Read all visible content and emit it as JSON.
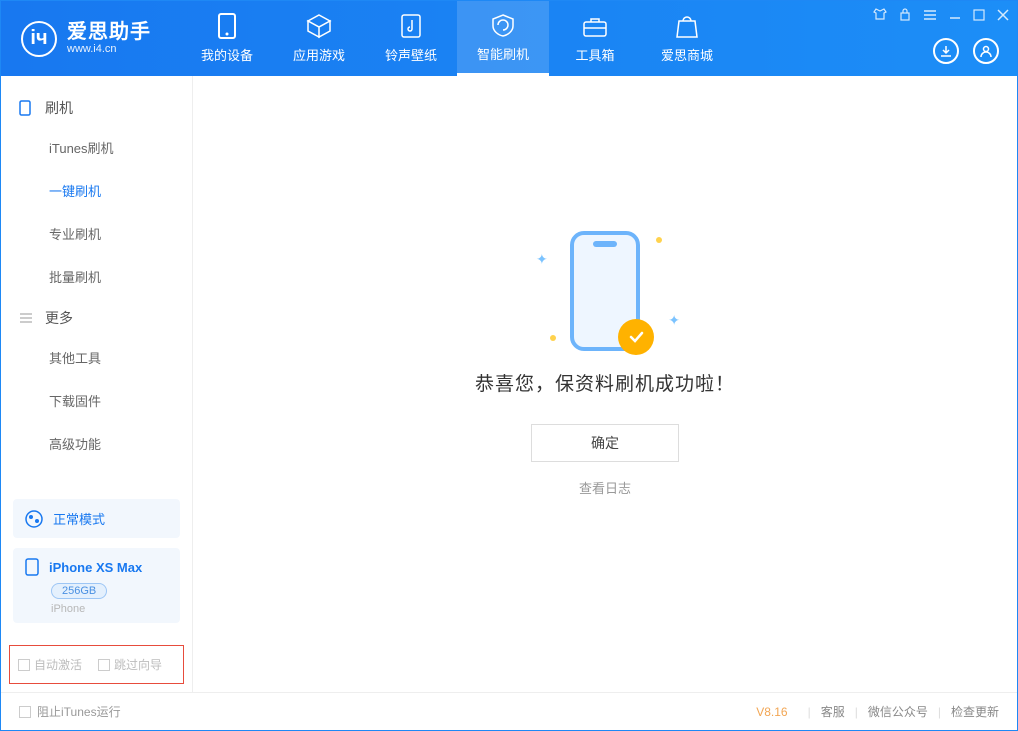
{
  "header": {
    "app_title": "爱思助手",
    "app_sub": "www.i4.cn",
    "tabs": [
      {
        "label": "我的设备"
      },
      {
        "label": "应用游戏"
      },
      {
        "label": "铃声壁纸"
      },
      {
        "label": "智能刷机"
      },
      {
        "label": "工具箱"
      },
      {
        "label": "爱思商城"
      }
    ]
  },
  "sidebar": {
    "section1": {
      "title": "刷机"
    },
    "items1": [
      {
        "label": "iTunes刷机"
      },
      {
        "label": "一键刷机"
      },
      {
        "label": "专业刷机"
      },
      {
        "label": "批量刷机"
      }
    ],
    "section2": {
      "title": "更多"
    },
    "items2": [
      {
        "label": "其他工具"
      },
      {
        "label": "下载固件"
      },
      {
        "label": "高级功能"
      }
    ],
    "mode_card": {
      "label": "正常模式"
    },
    "device_card": {
      "name": "iPhone XS Max",
      "storage": "256GB",
      "type": "iPhone"
    },
    "bottom_checks": {
      "auto_activate": "自动激活",
      "skip_guide": "跳过向导"
    }
  },
  "main": {
    "success_text": "恭喜您，保资料刷机成功啦！",
    "ok_label": "确定",
    "log_link": "查看日志"
  },
  "footer": {
    "block_itunes": "阻止iTunes运行",
    "version": "V8.16",
    "links": {
      "support": "客服",
      "wechat": "微信公众号",
      "update": "检查更新"
    }
  }
}
